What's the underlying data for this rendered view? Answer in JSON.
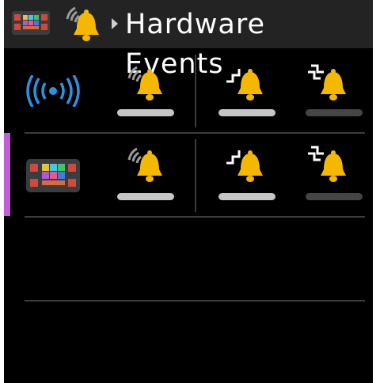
{
  "window": {
    "title": "Hardware Events",
    "app_icon": "controller-board-icon",
    "section_icon": "notification-bell-icon"
  },
  "colors": {
    "accent": "#c25ed6",
    "bell": "#f5b800",
    "bluetooth": "#2f8fe0",
    "on": "#c6c6c6",
    "off": "#454545"
  },
  "events": {
    "columns": [
      {
        "icon": "alert-bell-icon",
        "meaning": "connected"
      },
      {
        "icon": "rising-step-bell-icon",
        "meaning": "up"
      },
      {
        "icon": "double-step-bell-icon",
        "meaning": "down"
      }
    ]
  },
  "devices": [
    {
      "icon": "wireless-signal-icon",
      "states": [
        true,
        true,
        false
      ]
    },
    {
      "icon": "controller-board-icon",
      "states": [
        true,
        true,
        false
      ]
    }
  ],
  "selected_row": 1
}
